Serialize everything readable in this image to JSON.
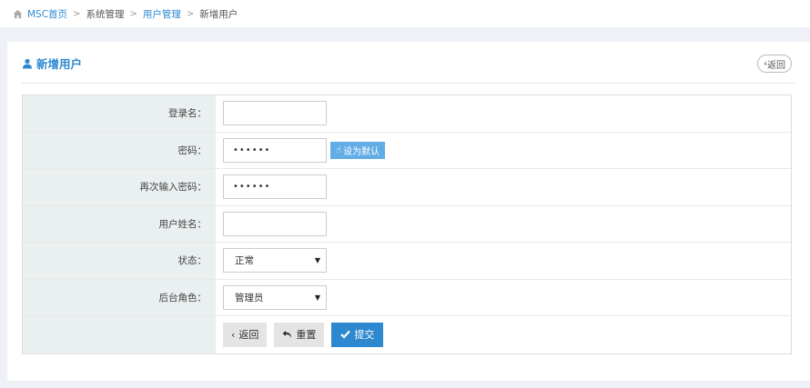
{
  "breadcrumb": {
    "home": "MSC首页",
    "items": [
      "系统管理",
      "用户管理",
      "新增用户"
    ],
    "separator": ">"
  },
  "page": {
    "title": "新增用户",
    "back_label": "返回",
    "back_prefix": "‹"
  },
  "form": {
    "fields": [
      {
        "label": "登录名：",
        "type": "text",
        "value": ""
      },
      {
        "label": "密码：",
        "type": "password",
        "value": "••••••",
        "extra_button": "设为默认"
      },
      {
        "label": "再次输入密码：",
        "type": "password",
        "value": "••••••"
      },
      {
        "label": "用户姓名：",
        "type": "text",
        "value": ""
      },
      {
        "label": "状态：",
        "type": "select",
        "value": "正常"
      },
      {
        "label": "后台角色：",
        "type": "select",
        "value": "管理员"
      }
    ],
    "buttons": {
      "back": "返回",
      "reset": "重置",
      "submit": "提交"
    }
  },
  "colors": {
    "accent": "#2f88d1",
    "submit": "#2d88cf",
    "default_btn": "#63ade6",
    "label_bg": "#eaeff0",
    "page_bg": "#eef2f8"
  },
  "icons": {
    "home": "home-icon",
    "user": "user-icon",
    "undo": "undo-icon",
    "check": "check-icon",
    "hand": "hand-pointer-icon"
  }
}
